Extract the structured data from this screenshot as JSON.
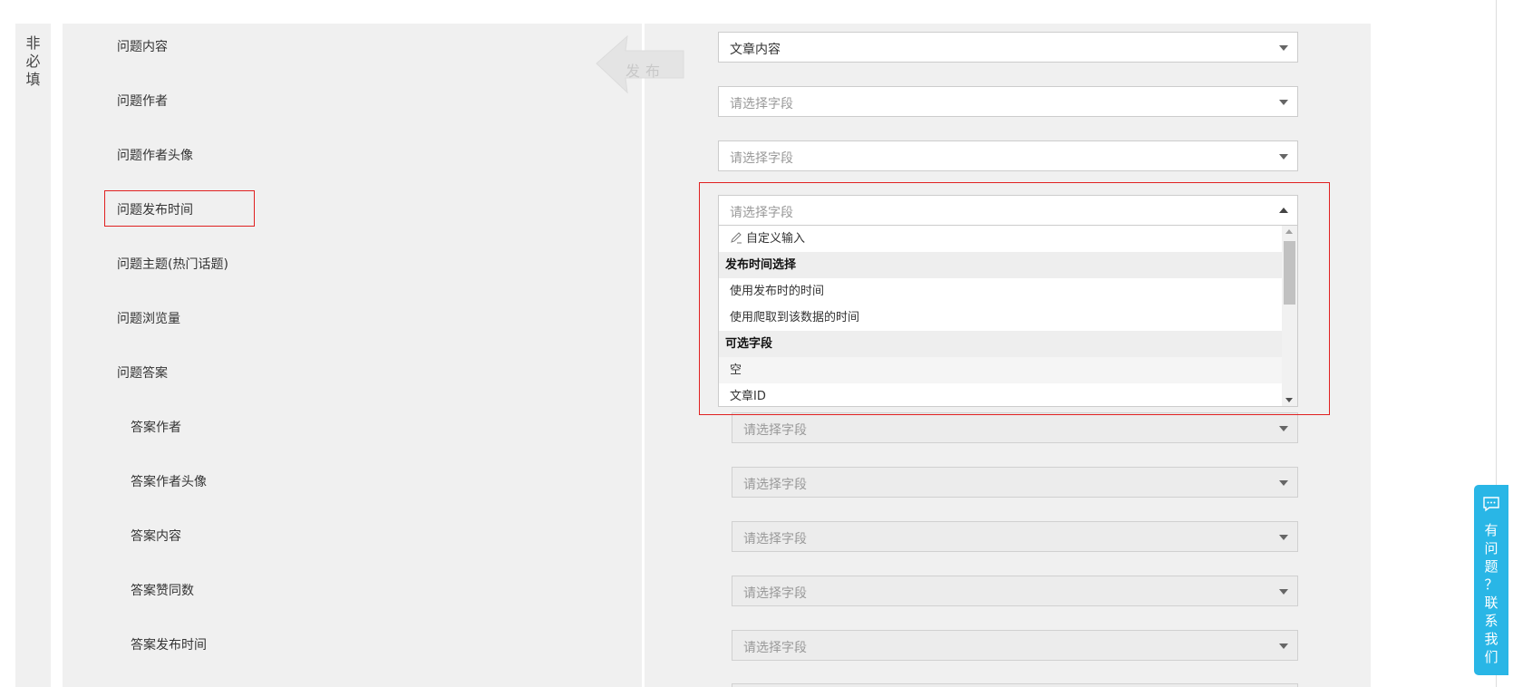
{
  "side_label": "非\n必\n填",
  "watermark": {
    "text": "发布"
  },
  "fields": [
    {
      "label": "问题内容",
      "value": "文章内容",
      "placeholder": ""
    },
    {
      "label": "问题作者",
      "value": "",
      "placeholder": "请选择字段"
    },
    {
      "label": "问题作者头像",
      "value": "",
      "placeholder": "请选择字段"
    },
    {
      "label": "问题发布时间",
      "value": "",
      "placeholder": "请选择字段"
    },
    {
      "label": "问题主题(热门话题)"
    },
    {
      "label": "问题浏览量"
    },
    {
      "label": "问题答案"
    }
  ],
  "answer_fields": [
    {
      "label": "答案作者",
      "placeholder": "请选择字段"
    },
    {
      "label": "答案作者头像",
      "placeholder": "请选择字段"
    },
    {
      "label": "答案内容",
      "placeholder": "请选择字段"
    },
    {
      "label": "答案赞同数",
      "placeholder": "请选择字段"
    },
    {
      "label": "答案发布时间",
      "placeholder": "请选择字段"
    }
  ],
  "dropdown": {
    "custom_input": "自定义输入",
    "group_time": "发布时间选择",
    "opt_publish_time": "使用发布时的时间",
    "opt_crawl_time": "使用爬取到该数据的时间",
    "group_fields": "可选字段",
    "opt_empty": "空",
    "opt_article_id": "文章ID"
  },
  "contact": {
    "text": "有\n问\n题\n？\n联\n系\n我\n们"
  },
  "colors": {
    "highlight": "#e02020",
    "contact_bg": "#29b6e6",
    "panel_bg": "#f0f0f0"
  }
}
